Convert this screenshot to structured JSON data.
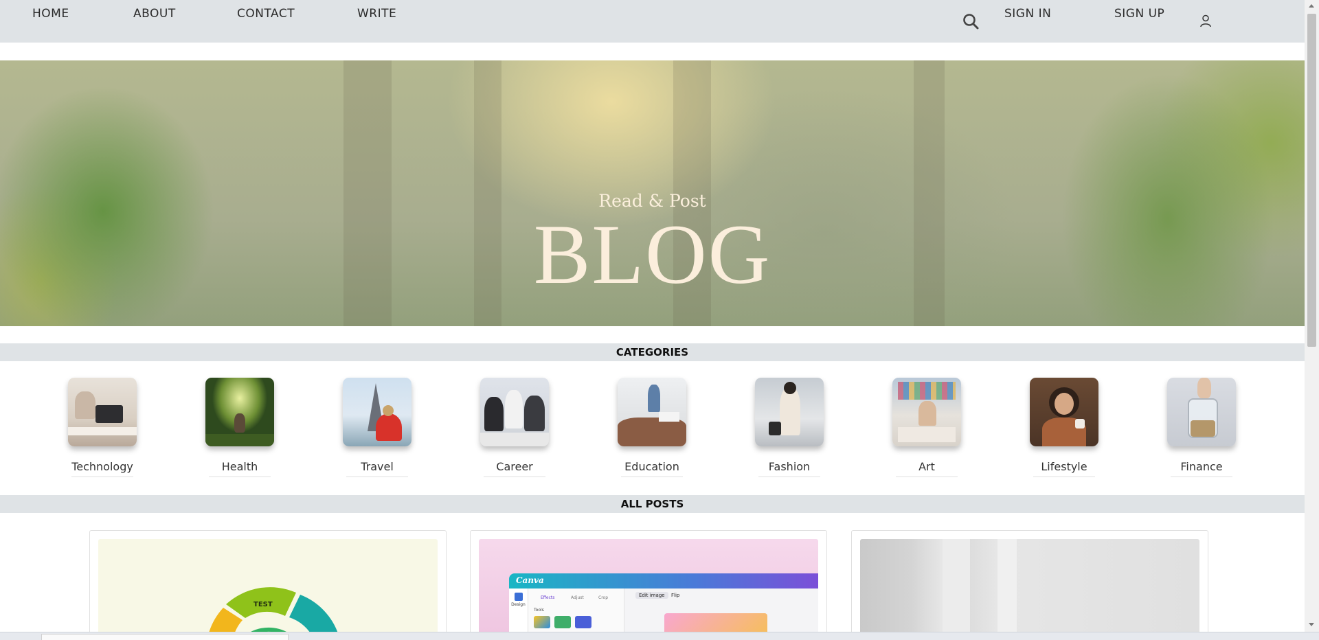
{
  "nav": {
    "home": "HOME",
    "about": "ABOUT",
    "contact": "CONTACT",
    "write": "WRITE",
    "sign_in": "SIGN IN",
    "sign_up": "SIGN UP",
    "search_icon": "search-icon",
    "user_icon": "user-icon"
  },
  "hero": {
    "subtitle": "Read & Post",
    "title": "BLOG"
  },
  "categories": {
    "heading": "CATEGORIES",
    "items": [
      {
        "label": "Technology"
      },
      {
        "label": "Health"
      },
      {
        "label": "Travel"
      },
      {
        "label": "Career"
      },
      {
        "label": "Education"
      },
      {
        "label": "Fashion"
      },
      {
        "label": "Art"
      },
      {
        "label": "Lifestyle"
      },
      {
        "label": "Finance"
      }
    ]
  },
  "posts": {
    "heading": "ALL POSTS",
    "card1_badge": "TEST",
    "card2_app": "Canva",
    "card2_tabs": [
      "Edit image",
      "Flip"
    ],
    "card2_sidebar": [
      "Design",
      "Effects",
      "Adjust",
      "Crop",
      "Tools"
    ]
  },
  "colors": {
    "nav_bg": "#dfe3e6",
    "hero_text": "#fbeedc",
    "section_bar_bg": "#dfe3e6"
  }
}
